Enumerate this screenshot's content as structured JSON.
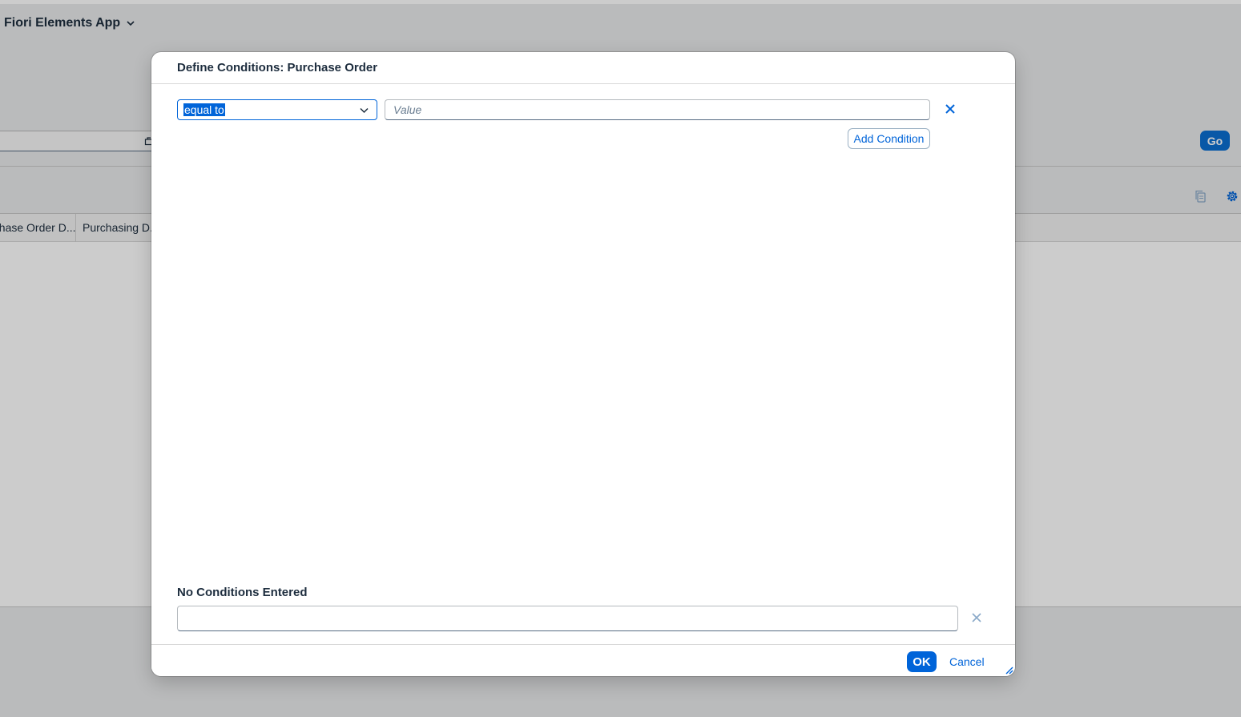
{
  "app": {
    "title": "Fiori Elements App",
    "go_label": "Go",
    "columns": [
      "Purchase Order D...",
      "Purchasing D..."
    ]
  },
  "dialog": {
    "title": "Define Conditions: Purchase Order",
    "operator": "equal to",
    "value_placeholder": "Value",
    "add_condition_label": "Add Condition",
    "summary_label": "No Conditions Entered",
    "ok_label": "OK",
    "cancel_label": "Cancel"
  },
  "icons": {
    "title_menu": "chevron-down-icon",
    "value_help": "value-help-icon",
    "copy": "copy-icon",
    "settings": "gear-icon",
    "operator_dropdown": "chevron-down-icon",
    "remove_condition": "close-icon",
    "clear_conditions": "close-icon",
    "resize": "resize-icon"
  },
  "colors": {
    "brand": "#0064d9",
    "go_button": "#0a6ed1",
    "text": "#1d2d3e"
  }
}
